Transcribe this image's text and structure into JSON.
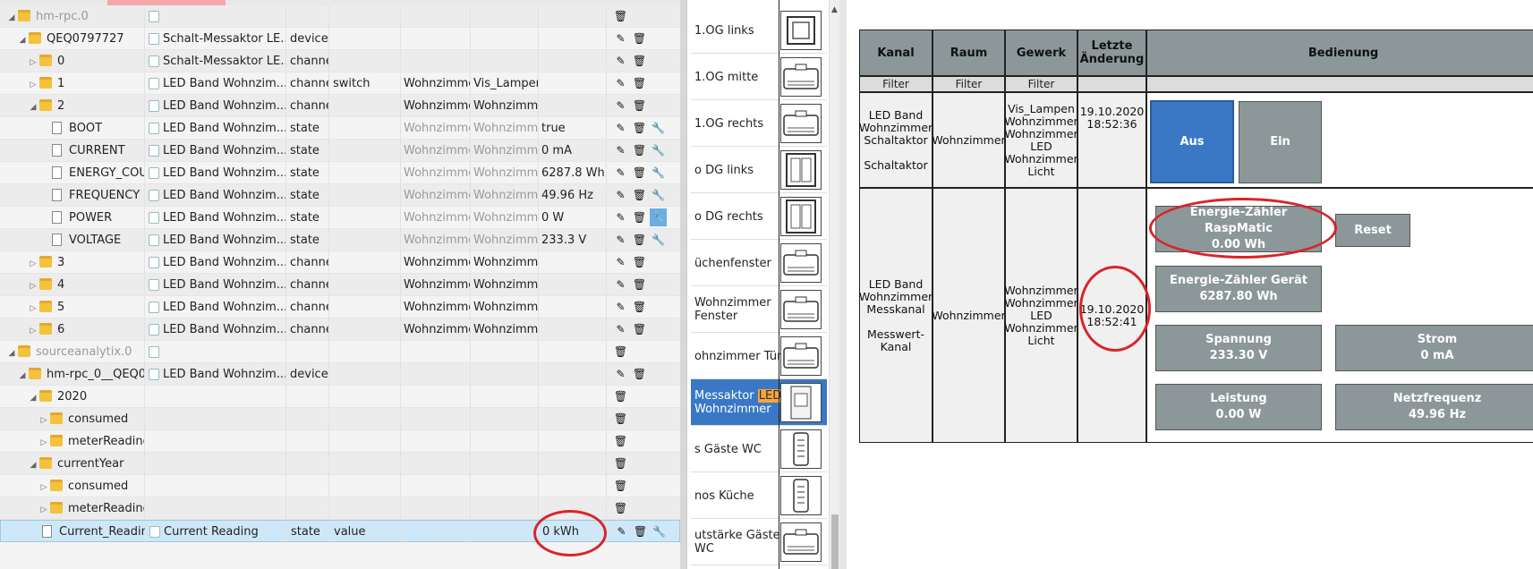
{
  "tree": {
    "rows": [
      {
        "indent": 0,
        "tri": "◢",
        "kind": "folder",
        "name": "hm-rpc.0",
        "name_grey": true,
        "icon": "adapter-icon",
        "title": "",
        "type": "",
        "role": "",
        "room": "",
        "func": "",
        "value": "",
        "btns": [
          "trash"
        ],
        "alt": true
      },
      {
        "indent": 1,
        "tri": "◢",
        "kind": "folder",
        "name": "QEQ0797727",
        "icon": "device-icon",
        "title": "Schalt-Messaktor LE...",
        "type": "device",
        "role": "",
        "room": "",
        "func": "",
        "value": "",
        "btns": [
          "edit",
          "trash"
        ]
      },
      {
        "indent": 2,
        "tri": "▷",
        "kind": "folder",
        "name": "0",
        "icon": "channel-icon",
        "title": "Schalt-Messaktor LE...",
        "type": "channe",
        "role": "",
        "room": "",
        "func": "",
        "value": "",
        "btns": [
          "edit",
          "trash"
        ],
        "alt": true
      },
      {
        "indent": 2,
        "tri": "▷",
        "kind": "folder",
        "name": "1",
        "icon": "channel-icon",
        "title": "LED Band Wohnzim...",
        "type": "channe",
        "role": "switch",
        "room": "Wohnzimme",
        "func": "Vis_Lampen,",
        "value": "",
        "btns": [
          "edit",
          "trash"
        ]
      },
      {
        "indent": 2,
        "tri": "◢",
        "kind": "folder",
        "name": "2",
        "icon": "channel-icon",
        "title": "LED Band Wohnzim...",
        "type": "channe",
        "role": "",
        "room": "Wohnzimme",
        "func": "Wohnzimme",
        "value": "",
        "btns": [
          "edit",
          "trash"
        ],
        "alt": true
      },
      {
        "indent": 3,
        "tri": "",
        "kind": "file",
        "name": "BOOT",
        "icon": "state-icon",
        "title": "LED Band Wohnzim...",
        "type": "state",
        "role": "",
        "room": "Wohnzimme",
        "func": "Wohnzimme",
        "value": "true",
        "grey_rf": true,
        "btns": [
          "edit",
          "trash",
          "wrench"
        ]
      },
      {
        "indent": 3,
        "tri": "",
        "kind": "file",
        "name": "CURRENT",
        "icon": "state-icon",
        "title": "LED Band Wohnzim...",
        "type": "state",
        "role": "",
        "room": "Wohnzimme",
        "func": "Wohnzimme",
        "value": "0 mA",
        "grey_rf": true,
        "btns": [
          "edit",
          "trash",
          "wrench"
        ],
        "alt": true
      },
      {
        "indent": 3,
        "tri": "",
        "kind": "file",
        "name": "ENERGY_COUN",
        "icon": "state-icon",
        "title": "LED Band Wohnzim...",
        "type": "state",
        "role": "",
        "room": "Wohnzimme",
        "func": "Wohnzimme",
        "value": "6287.8 Wh",
        "grey_rf": true,
        "btns": [
          "edit",
          "trash",
          "wrench"
        ]
      },
      {
        "indent": 3,
        "tri": "",
        "kind": "file",
        "name": "FREQUENCY",
        "icon": "state-icon",
        "title": "LED Band Wohnzim...",
        "type": "state",
        "role": "",
        "room": "Wohnzimme",
        "func": "Wohnzimme",
        "value": "49.96 Hz",
        "grey_rf": true,
        "btns": [
          "edit",
          "trash",
          "wrench"
        ],
        "alt": true
      },
      {
        "indent": 3,
        "tri": "",
        "kind": "file",
        "name": "POWER",
        "icon": "state-icon",
        "title": "LED Band Wohnzim...",
        "type": "state",
        "role": "",
        "room": "Wohnzimme",
        "func": "Wohnzimme",
        "value": "0 W",
        "grey_rf": true,
        "btns": [
          "edit",
          "trash",
          "wrench-hl"
        ]
      },
      {
        "indent": 3,
        "tri": "",
        "kind": "file",
        "name": "VOLTAGE",
        "icon": "state-icon",
        "title": "LED Band Wohnzim...",
        "type": "state",
        "role": "",
        "room": "Wohnzimme",
        "func": "Wohnzimme",
        "value": "233.3 V",
        "grey_rf": true,
        "btns": [
          "edit",
          "trash",
          "wrench"
        ],
        "alt": true
      },
      {
        "indent": 2,
        "tri": "▷",
        "kind": "folder",
        "name": "3",
        "icon": "channel-icon",
        "title": "LED Band Wohnzim...",
        "type": "channe",
        "role": "",
        "room": "Wohnzimme",
        "func": "Wohnzimme",
        "value": "",
        "btns": [
          "edit",
          "trash"
        ]
      },
      {
        "indent": 2,
        "tri": "▷",
        "kind": "folder",
        "name": "4",
        "icon": "channel-icon",
        "title": "LED Band Wohnzim...",
        "type": "channe",
        "role": "",
        "room": "Wohnzimme",
        "func": "Wohnzimme",
        "value": "",
        "btns": [
          "edit",
          "trash"
        ],
        "alt": true
      },
      {
        "indent": 2,
        "tri": "▷",
        "kind": "folder",
        "name": "5",
        "icon": "channel-icon",
        "title": "LED Band Wohnzim...",
        "type": "channe",
        "role": "",
        "room": "Wohnzimme",
        "func": "Wohnzimme",
        "value": "",
        "btns": [
          "edit",
          "trash"
        ]
      },
      {
        "indent": 2,
        "tri": "▷",
        "kind": "folder",
        "name": "6",
        "icon": "channel-icon",
        "title": "LED Band Wohnzim...",
        "type": "channe",
        "role": "",
        "room": "Wohnzimme",
        "func": "Wohnzimme",
        "value": "",
        "btns": [
          "edit",
          "trash"
        ],
        "alt": true
      },
      {
        "indent": 0,
        "tri": "◢",
        "kind": "folder",
        "name": "sourceanalytix.0",
        "name_grey": true,
        "icon": "adapter-icon",
        "title": "",
        "type": "",
        "role": "",
        "room": "",
        "func": "",
        "value": "",
        "btns": [
          "trash"
        ]
      },
      {
        "indent": 1,
        "tri": "◢",
        "kind": "folder",
        "name": "hm-rpc_0__QEQ0",
        "icon": "device-icon",
        "title": "LED Band Wohnzim...",
        "type": "device",
        "role": "",
        "room": "",
        "func": "",
        "value": "",
        "btns": [
          "edit",
          "trash"
        ],
        "alt": true
      },
      {
        "indent": 2,
        "tri": "◢",
        "kind": "folder",
        "name": "2020",
        "icon": "",
        "title": "",
        "type": "",
        "role": "",
        "room": "",
        "func": "",
        "value": "",
        "btns": [
          "trash"
        ]
      },
      {
        "indent": 3,
        "tri": "▷",
        "kind": "folder",
        "name": "consumed",
        "icon": "",
        "title": "",
        "type": "",
        "role": "",
        "room": "",
        "func": "",
        "value": "",
        "btns": [
          "trash"
        ],
        "alt": true
      },
      {
        "indent": 3,
        "tri": "▷",
        "kind": "folder",
        "name": "meterReadings",
        "icon": "",
        "title": "",
        "type": "",
        "role": "",
        "room": "",
        "func": "",
        "value": "",
        "btns": [
          "trash"
        ]
      },
      {
        "indent": 2,
        "tri": "◢",
        "kind": "folder",
        "name": "currentYear",
        "icon": "",
        "title": "",
        "type": "",
        "role": "",
        "room": "",
        "func": "",
        "value": "",
        "btns": [
          "trash"
        ],
        "alt": true
      },
      {
        "indent": 3,
        "tri": "▷",
        "kind": "folder",
        "name": "consumed",
        "icon": "",
        "title": "",
        "type": "",
        "role": "",
        "room": "",
        "func": "",
        "value": "",
        "btns": [
          "trash"
        ]
      },
      {
        "indent": 3,
        "tri": "▷",
        "kind": "folder",
        "name": "meterReadings",
        "icon": "",
        "title": "",
        "type": "",
        "role": "",
        "room": "",
        "func": "",
        "value": "",
        "btns": [
          "trash"
        ],
        "alt": true
      },
      {
        "indent": 2,
        "tri": "",
        "kind": "file",
        "name": "Current_Reading",
        "icon": "state-icon",
        "title": "Current Reading",
        "type": "state",
        "role": "value",
        "room": "",
        "func": "",
        "value": "0 kWh",
        "btns": [
          "edit",
          "trash",
          "wrench"
        ],
        "selected": true
      }
    ]
  },
  "middle": {
    "items": [
      {
        "label": "1.OG links",
        "pic": "switch"
      },
      {
        "label": "1.OG mitte",
        "pic": "actuator"
      },
      {
        "label": "1.OG rechts",
        "pic": "actuator"
      },
      {
        "label": "o DG links",
        "pic": "double"
      },
      {
        "label": "o DG rechts",
        "pic": "double"
      },
      {
        "label": "üchenfenster",
        "pic": "actuator"
      },
      {
        "label": "Wohnzimmer Fenster",
        "pic": "actuator"
      },
      {
        "label": "ohnzimmer Tür",
        "pic": "actuator"
      },
      {
        "label_pre": "Messaktor ",
        "label_hl": "LED",
        "label_post": " Wohnzimmer",
        "pic": "din",
        "active": true
      },
      {
        "label": "s Gäste WC",
        "pic": "remote"
      },
      {
        "label": "nos Küche",
        "pic": "remote"
      },
      {
        "label": "utstärke Gäste WC",
        "pic": "actuator"
      }
    ]
  },
  "table": {
    "headers": {
      "kanal": "Kanal",
      "raum": "Raum",
      "gewerk": "Gewerk",
      "letzte": "Letzte Änderung",
      "bedienung": "Bedienung"
    },
    "filter": "Filter",
    "row1": {
      "kanal_line1": "LED Band",
      "kanal_line2": "Wohnzimmer",
      "kanal_line3": "Schaltaktor",
      "kanal_line4": "Schaltaktor",
      "raum": "Wohnzimmer",
      "gewerk_lines": [
        "Vis_Lampen",
        "Wohnzimmer",
        "Wohnzimmer",
        "LED",
        "Wohnzimmer",
        "Licht"
      ],
      "date": "19.10.2020",
      "time": "18:52:36",
      "btn_aus": "Aus",
      "btn_ein": "Ein"
    },
    "row2": {
      "kanal_line1": "LED Band",
      "kanal_line2": "Wohnzimmer",
      "kanal_line3": "Messkanal",
      "kanal_line4": "Messwert-",
      "kanal_line5": "Kanal",
      "raum": "Wohnzimmer",
      "gewerk_lines": [
        "Wohnzimmer",
        "Wohnzimmer",
        "LED",
        "Wohnzimmer",
        "Licht"
      ],
      "date": "19.10.2020",
      "time": "18:52:41",
      "energy_rasp_label": "Energie-Zähler RaspMatic",
      "energy_rasp_value": "0.00 Wh",
      "reset": "Reset",
      "energy_dev_label": "Energie-Zähler Gerät",
      "energy_dev_value": "6287.80 Wh",
      "spannung_label": "Spannung",
      "spannung_value": "233.30 V",
      "strom_label": "Strom",
      "strom_value": "0 mA",
      "leistung_label": "Leistung",
      "leistung_value": "0.00 W",
      "netz_label": "Netzfrequenz",
      "netz_value": "49.96 Hz"
    }
  },
  "colors": {
    "annotation": "#d8252a",
    "accent": "#3a78c6",
    "tile": "#8c9799"
  }
}
